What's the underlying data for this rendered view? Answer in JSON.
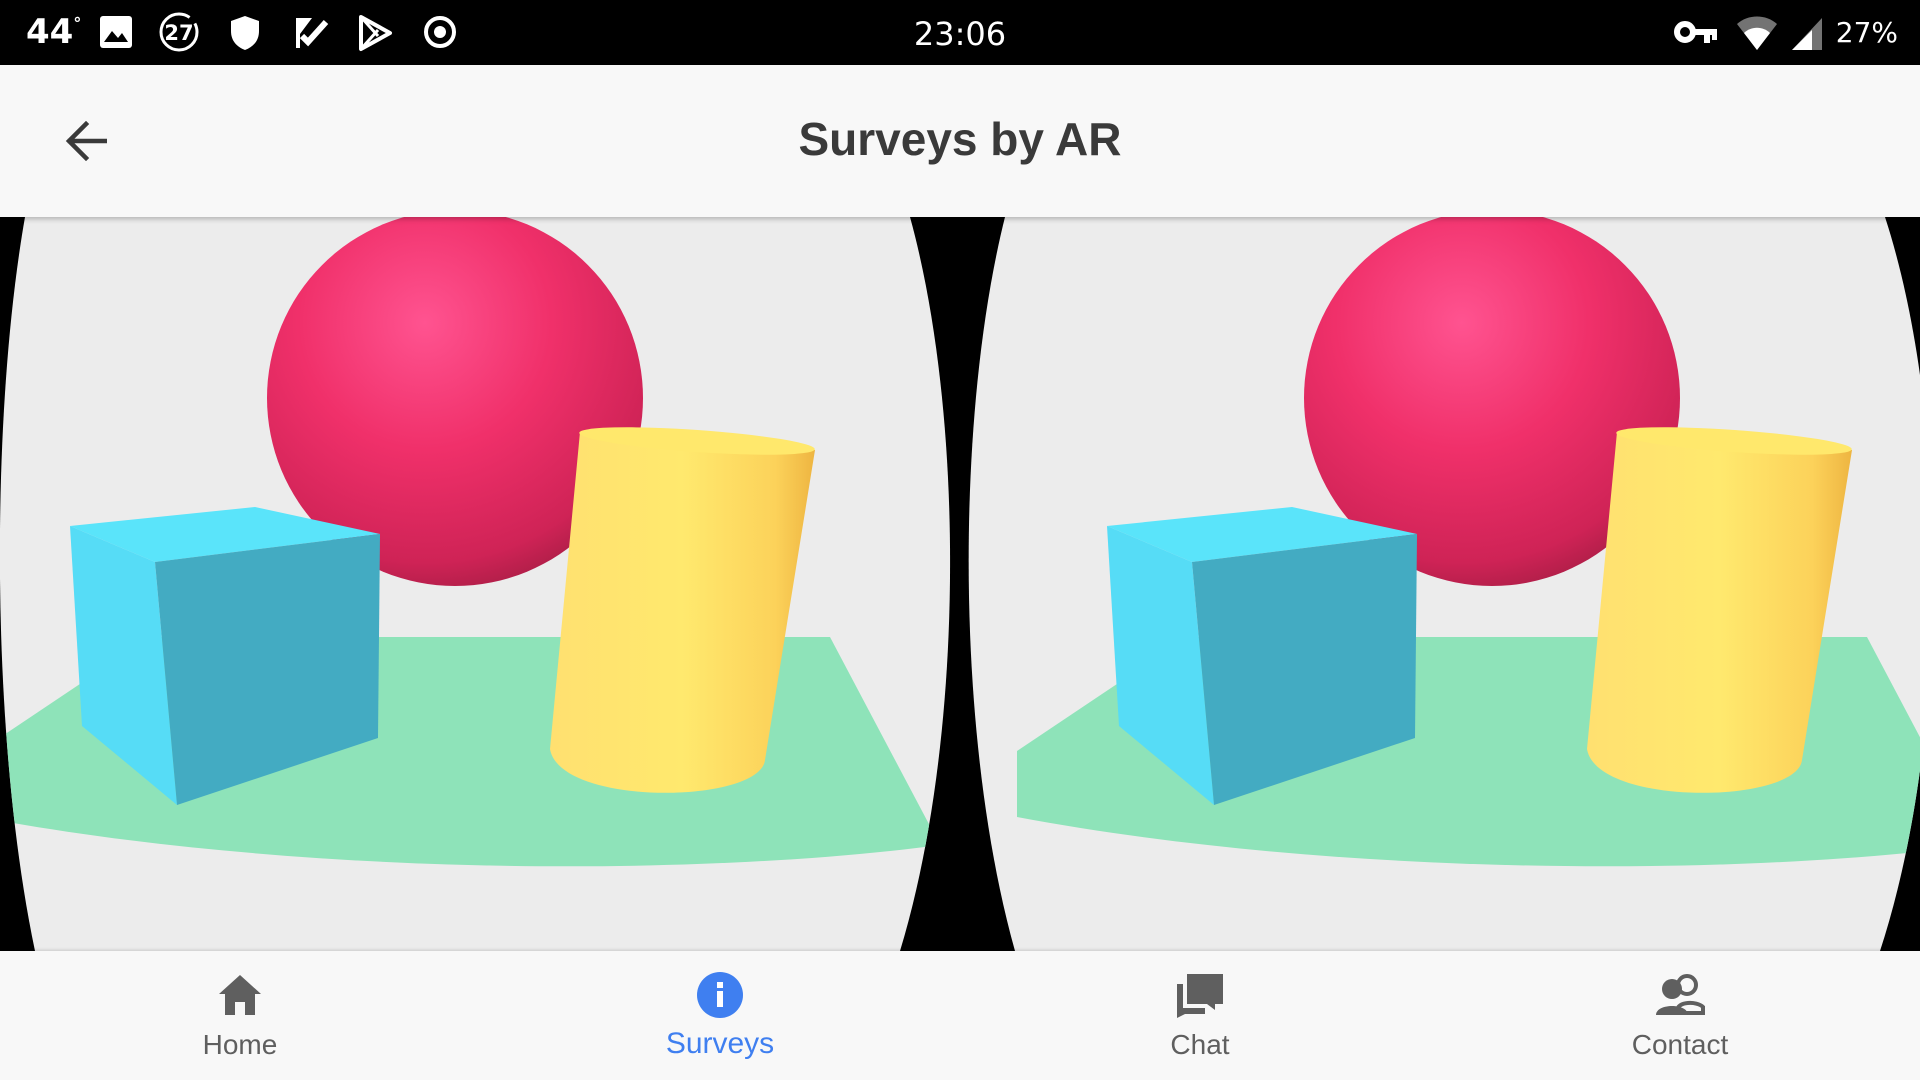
{
  "status_bar": {
    "temperature": "44",
    "temperature_unit": "°",
    "notification_count": "27",
    "time": "23:06",
    "battery_percent": "27%",
    "icons": [
      "image-icon",
      "badge-27-icon",
      "shield-icon",
      "check-app-icon",
      "play-store-icon",
      "record-icon",
      "vpn-key-icon",
      "wifi-icon",
      "signal-icon"
    ]
  },
  "app_bar": {
    "title": "Surveys by AR",
    "back_icon": "arrow-back-icon"
  },
  "vr_scene": {
    "type": "stereoscopic-3d-view",
    "objects": [
      "red-sphere",
      "cyan-cube",
      "yellow-cylinder",
      "green-ground-plane"
    ],
    "colors": {
      "sphere": "#f0306a",
      "cube_front": "#43abc2",
      "cube_side": "#56dcf6",
      "cylinder": "#ffe46a",
      "ground": "#8ee3b9",
      "sky": "#ececec"
    }
  },
  "bottom_nav": {
    "active": "surveys",
    "active_color": "#3f7ff0",
    "inactive_color": "#5f5f5f",
    "items": [
      {
        "id": "home",
        "label": "Home",
        "icon": "home-icon"
      },
      {
        "id": "surveys",
        "label": "Surveys",
        "icon": "info-icon"
      },
      {
        "id": "chat",
        "label": "Chat",
        "icon": "chat-icon"
      },
      {
        "id": "contact",
        "label": "Contact",
        "icon": "contacts-icon"
      }
    ]
  }
}
